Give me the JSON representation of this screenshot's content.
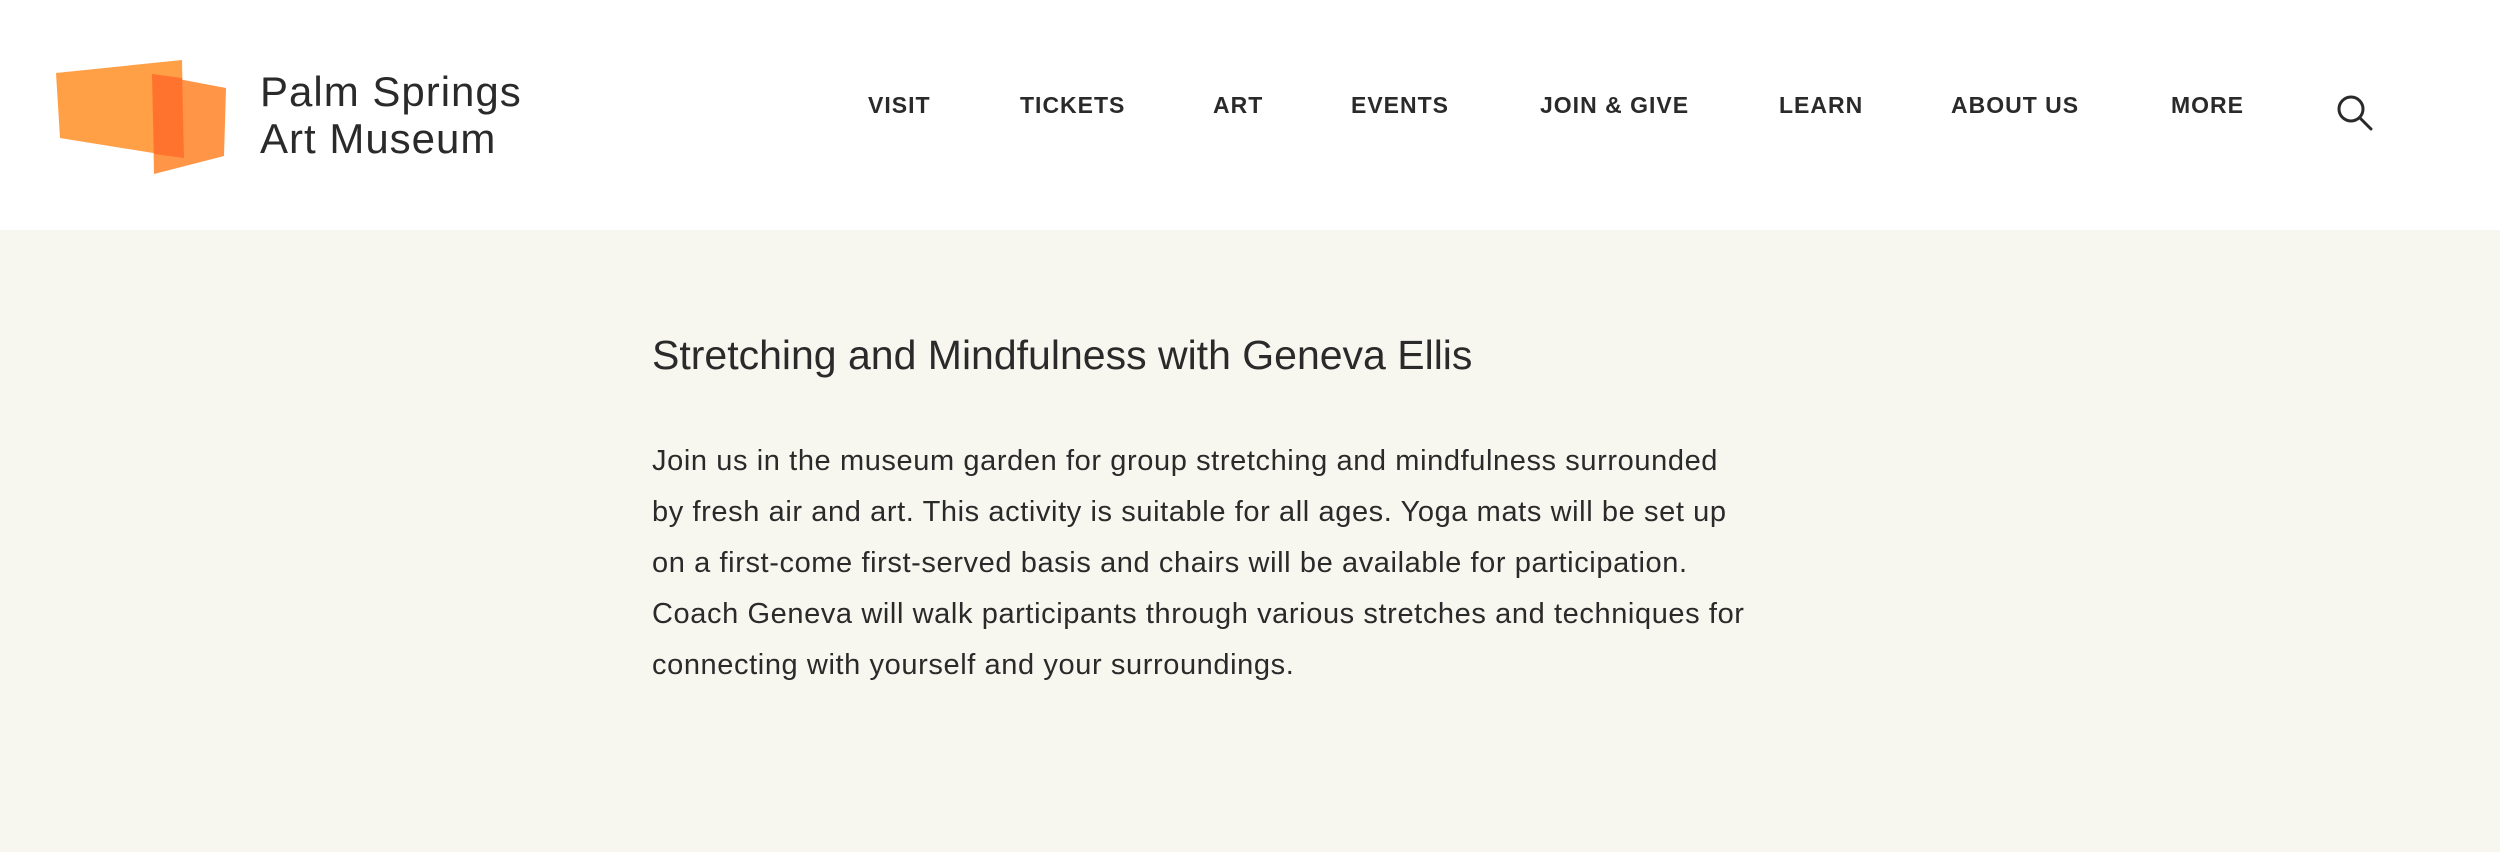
{
  "brand": {
    "name_line1": "Palm Springs",
    "name_line2": "Art Museum",
    "logo_colors": [
      "#ff9a3c",
      "#ff7a33"
    ]
  },
  "nav": {
    "items": [
      {
        "label": "VISIT"
      },
      {
        "label": "TICKETS"
      },
      {
        "label": "ART"
      },
      {
        "label": "EVENTS"
      },
      {
        "label": "JOIN & GIVE"
      },
      {
        "label": "LEARN"
      },
      {
        "label": "ABOUT US"
      },
      {
        "label": "MORE"
      }
    ],
    "search_icon": "search-icon"
  },
  "event": {
    "title": "Stretching and Mindfulness with Geneva Ellis",
    "description": "Join us in the museum garden for group stretching and mindfulness surrounded by fresh air and art. This activity is suitable for all ages. Yoga mats will be set up on a first-come first-served basis and chairs will be available for participation. Coach Geneva will walk participants through various stretches and techniques for connecting with yourself and your surroundings."
  },
  "colors": {
    "header_bg": "#ffffff",
    "content_bg": "#f7f7f0",
    "text": "#2a2a2a",
    "accent": "#ff9a3c"
  }
}
